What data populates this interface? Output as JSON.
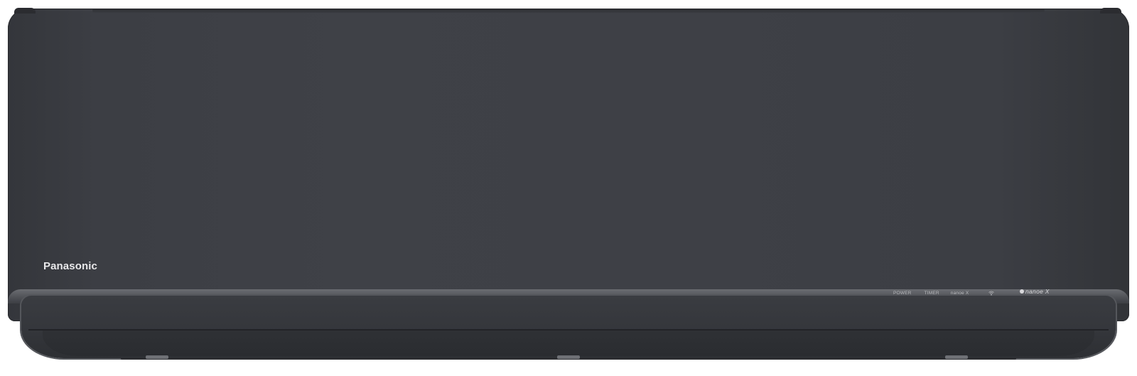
{
  "product": {
    "brand": "Panasonic",
    "body_color": "#3e4046",
    "trim_color": "#6b6d72"
  },
  "indicators": {
    "power": "POWER",
    "timer": "TIMER",
    "nanoe": "nanoe X",
    "wifi_icon": "wifi-icon"
  },
  "badge": {
    "text": "nanoe X",
    "icon": "nanoe-dot-icon"
  }
}
